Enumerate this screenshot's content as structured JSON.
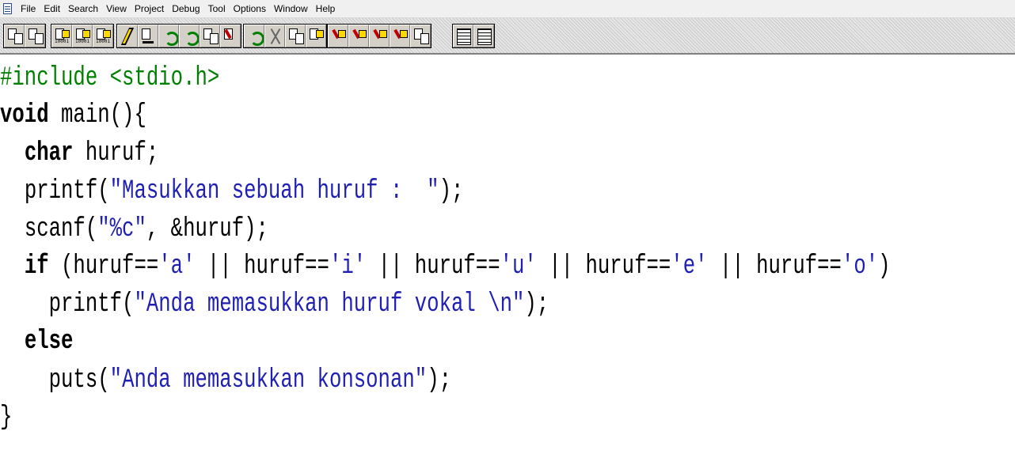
{
  "menu": {
    "items": [
      "File",
      "Edit",
      "Search",
      "View",
      "Project",
      "Debug",
      "Tool",
      "Options",
      "Window",
      "Help"
    ]
  },
  "toolbar": {
    "icons": [
      "new-file-icon",
      "open-file-icon",
      "compile-icon",
      "build-icon",
      "rebuild-icon",
      "run-icon",
      "step-into-icon",
      "step-over-icon",
      "step-out-icon",
      "debug-icon",
      "undo-icon",
      "cut-icon",
      "copy-icon",
      "paste-icon",
      "find-icon",
      "find-replace-icon",
      "find-next-icon",
      "replace-icon",
      "goto-icon",
      "window-icon",
      "tile-icon"
    ]
  },
  "colors": {
    "preprocessor": "#008000",
    "string": "#1f1fb3",
    "keyword": "#000000",
    "text": "#000000"
  },
  "code": {
    "line1": {
      "directive": "#include <stdio.h>"
    },
    "line2": {
      "kw": "void",
      "rest": " main(){"
    },
    "line3": {
      "indent": "  ",
      "kw": "char",
      "rest": " huruf;"
    },
    "line4": {
      "indent": "  ",
      "pre": "printf(",
      "str": "\"Masukkan sebuah huruf :  \"",
      "post": ");"
    },
    "line5": {
      "indent": "  ",
      "pre": "scanf(",
      "str": "\"%c\"",
      "post": ", &huruf);"
    },
    "line6": {
      "indent": "  ",
      "kw": "if",
      "p1": " (huruf==",
      "s1": "'a'",
      "p2": " || huruf==",
      "s2": "'i'",
      "p3": " || huruf==",
      "s3": "'u'",
      "p4": " || huruf==",
      "s4": "'e'",
      "p5": " || huruf==",
      "s5": "'o'",
      "p6": ")"
    },
    "line7": {
      "indent": "    ",
      "pre": "printf(",
      "str": "\"Anda memasukkan huruf vokal \\n\"",
      "post": ");"
    },
    "line8": {
      "indent": "  ",
      "kw": "else"
    },
    "line9": {
      "indent": "    ",
      "pre": "puts(",
      "str": "\"Anda memasukkan konsonan\"",
      "post": ");"
    },
    "line10": {
      "rest": "}"
    }
  }
}
